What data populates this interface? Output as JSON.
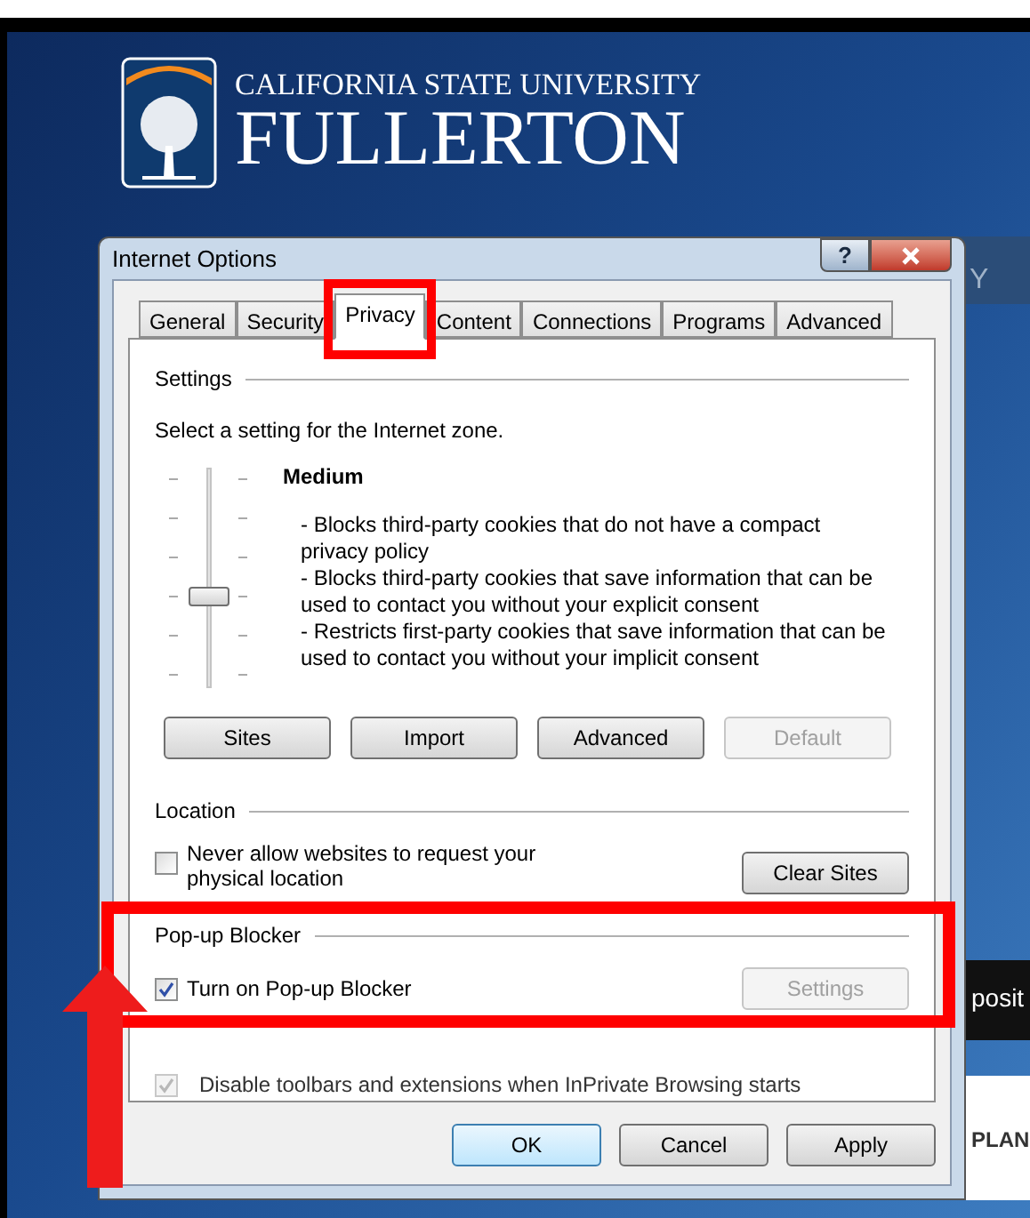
{
  "site": {
    "logo_line1": "CALIFORNIA STATE UNIVERSITY",
    "logo_line2": "FULLERTON",
    "fragments": [
      "Y",
      "posit",
      "PLAN"
    ]
  },
  "dialog": {
    "title": "Internet Options",
    "help_label": "?",
    "tabs": [
      {
        "label": "General",
        "selected": false
      },
      {
        "label": "Security",
        "selected": false
      },
      {
        "label": "Privacy",
        "selected": true
      },
      {
        "label": "Content",
        "selected": false
      },
      {
        "label": "Connections",
        "selected": false
      },
      {
        "label": "Programs",
        "selected": false
      },
      {
        "label": "Advanced",
        "selected": false
      }
    ],
    "settings": {
      "heading": "Settings",
      "prompt": "Select a setting for the Internet zone.",
      "level_name": "Medium",
      "level": 0.4,
      "description": [
        "- Blocks third-party cookies that do not have a compact privacy policy",
        "- Blocks third-party cookies that save information that can be used to contact you without your explicit consent",
        "- Restricts first-party cookies that save information that can be used to contact you without your implicit consent"
      ],
      "buttons": [
        {
          "label": "Sites",
          "disabled": false
        },
        {
          "label": "Import",
          "disabled": false
        },
        {
          "label": "Advanced",
          "disabled": false
        },
        {
          "label": "Default",
          "disabled": true
        }
      ]
    },
    "location": {
      "heading": "Location",
      "checkbox": {
        "label": "Never allow websites to request your physical location",
        "checked": false
      },
      "button": {
        "label": "Clear Sites",
        "disabled": false
      }
    },
    "popup": {
      "heading": "Pop-up Blocker",
      "checkbox": {
        "label": "Turn on Pop-up Blocker",
        "checked": true
      },
      "button": {
        "label": "Settings",
        "disabled": true
      }
    },
    "inprivate": {
      "label": "Disable toolbars and extensions when InPrivate Browsing starts",
      "checked": true,
      "disabled": true
    },
    "footer_buttons": [
      {
        "label": "OK",
        "default": true
      },
      {
        "label": "Cancel",
        "default": false
      },
      {
        "label": "Apply",
        "default": false
      }
    ]
  }
}
